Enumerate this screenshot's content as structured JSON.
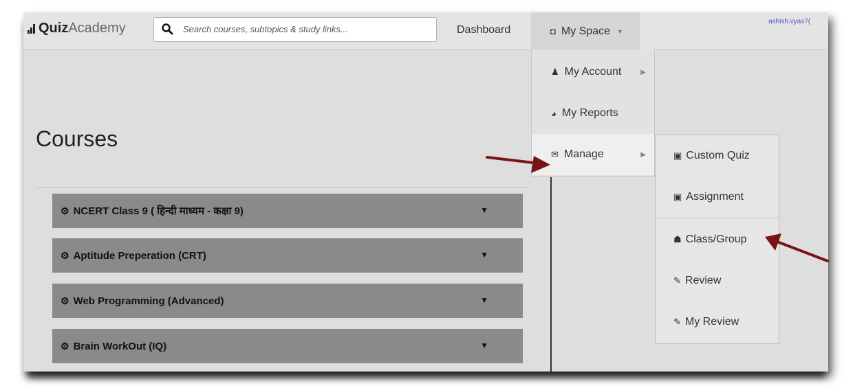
{
  "brand": {
    "bold": "Quiz",
    "light": "Academy"
  },
  "search": {
    "placeholder": "Search courses, subtopics & study links..."
  },
  "nav": {
    "dashboard": "Dashboard",
    "my_space": "My Space",
    "user": "ashish.vyas7("
  },
  "page": {
    "title": "Courses"
  },
  "courses": [
    "NCERT Class 9 ( हिन्दी माध्यम - कक्षा 9)",
    "Aptitude Preperation (CRT)",
    "Web Programming (Advanced)",
    "Brain WorkOut (IQ)"
  ],
  "menu": {
    "my_account": "My Account",
    "my_reports": "My Reports",
    "manage": "Manage"
  },
  "submenu": {
    "custom_quiz": "Custom Quiz",
    "assignment": "Assignment",
    "class_group": "Class/Group",
    "review": "Review",
    "my_review": "My Review"
  },
  "colors": {
    "accordion": "#8a8a8a",
    "arrow": "#7a1414",
    "link": "#4a55c8"
  }
}
